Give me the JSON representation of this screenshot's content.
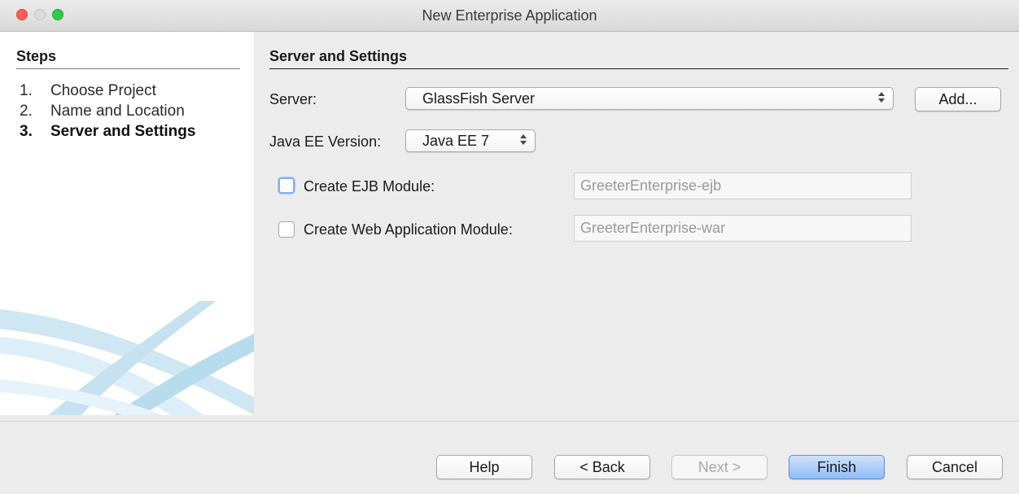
{
  "window": {
    "title": "New Enterprise Application"
  },
  "steps": {
    "heading": "Steps",
    "items": [
      {
        "num": "1.",
        "label": "Choose Project"
      },
      {
        "num": "2.",
        "label": "Name and Location"
      },
      {
        "num": "3.",
        "label": "Server and Settings"
      }
    ],
    "current_index": 2
  },
  "panel": {
    "heading": "Server and Settings",
    "server_label": "Server:",
    "server_value": "GlassFish Server",
    "add_button": "Add...",
    "javaee_label": "Java EE Version:",
    "javaee_value": "Java EE 7",
    "ejb_checkbox_label": "Create EJB Module:",
    "ejb_checked": false,
    "ejb_value": "GreeterEnterprise-ejb",
    "war_checkbox_label": "Create Web Application Module:",
    "war_checked": false,
    "war_value": "GreeterEnterprise-war"
  },
  "buttons": {
    "help": "Help",
    "back": "< Back",
    "next": "Next >",
    "finish": "Finish",
    "cancel": "Cancel"
  },
  "colors": {
    "window_bg": "#ececec",
    "default_button": "#8fbdf5",
    "close_light": "#fc5f57",
    "maximize_light": "#34c84a"
  }
}
